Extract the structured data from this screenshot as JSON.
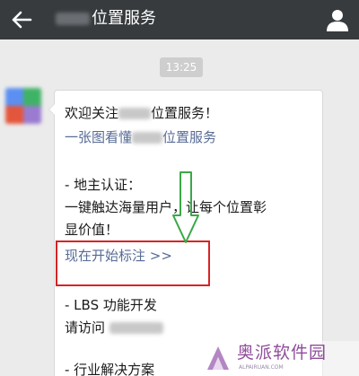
{
  "header": {
    "back_icon": "back-arrow-icon",
    "title": "位置服务",
    "profile_icon": "person-icon",
    "bg_color": "#373b3e"
  },
  "chat": {
    "timestamp": "13:25",
    "message": {
      "greeting_prefix": "欢迎关注",
      "greeting_suffix": "位置服务！",
      "link_prefix": "一张图看懂",
      "link_suffix": "位置服务",
      "section1_heading": "- 地主认证：",
      "section1_line1": "一键触达海量用户，让每个位置彰",
      "section1_line2": "显价值！",
      "start_link": "现在开始标注 >>",
      "section2_heading": "- LBS 功能开发",
      "section2_line": "请访问",
      "section3_heading": "- 行业解决方案"
    },
    "link_color": "#576b95"
  },
  "annotations": {
    "highlight_color": "#d62424",
    "arrow_color": "#3aa847"
  },
  "watermark": {
    "text": "奥派软件园",
    "subtext": "ALPAIRUAN.COM",
    "color": "#8f4c9a"
  }
}
